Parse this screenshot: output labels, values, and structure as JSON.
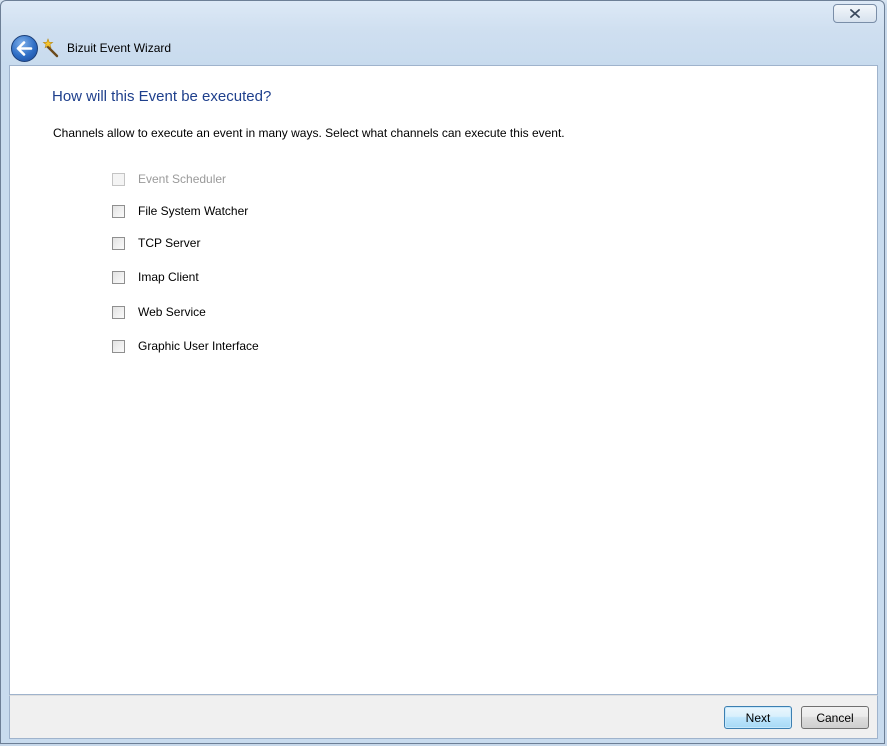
{
  "window": {
    "title": "Bizuit Event Wizard"
  },
  "page": {
    "heading": "How will this Event be executed?",
    "instructions": "Channels allow to execute an event in many ways. Select what channels can execute this event."
  },
  "channels": [
    {
      "label": "Event Scheduler",
      "checked": false,
      "enabled": false
    },
    {
      "label": "File System Watcher",
      "checked": false,
      "enabled": true
    },
    {
      "label": "TCP Server",
      "checked": false,
      "enabled": true
    },
    {
      "label": "Imap Client",
      "checked": false,
      "enabled": true
    },
    {
      "label": "Web Service",
      "checked": false,
      "enabled": true
    },
    {
      "label": "Graphic User Interface",
      "checked": false,
      "enabled": true
    }
  ],
  "buttons": {
    "next": "Next",
    "cancel": "Cancel"
  },
  "icons": {
    "back": "back-arrow-icon",
    "wizard": "magic-wand-icon",
    "close": "close-icon"
  },
  "colors": {
    "heading": "#1e3f8c",
    "frame": "#c8dbee",
    "next_border": "#3c7fb1"
  }
}
